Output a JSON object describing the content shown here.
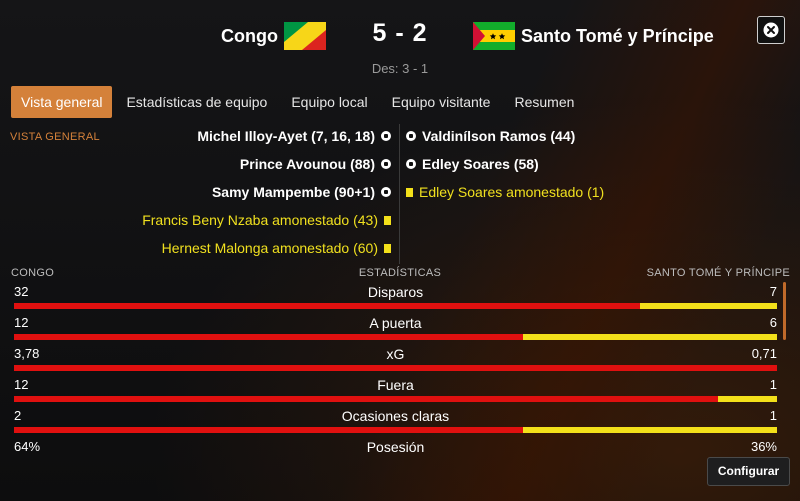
{
  "match": {
    "home_team": "Congo",
    "away_team": "Santo Tomé y Príncipe",
    "score": "5 - 2",
    "halftime": "Des: 3 - 1"
  },
  "tabs": [
    {
      "label": "Vista general",
      "active": true
    },
    {
      "label": "Estadísticas de equipo",
      "active": false
    },
    {
      "label": "Equipo local",
      "active": false
    },
    {
      "label": "Equipo visitante",
      "active": false
    },
    {
      "label": "Resumen",
      "active": false
    }
  ],
  "section_label": "VISTA GENERAL",
  "events": {
    "home": [
      {
        "text": "Michel Illoy-Ayet (7, 16, 18)",
        "icon": "ball-icon"
      },
      {
        "text": "Prince Avounou (88)",
        "icon": "ball-icon"
      },
      {
        "text": "Samy Mampembe (90+1)",
        "icon": "ball-icon"
      },
      {
        "text": "Francis Beny Nzaba amonestado (43)",
        "icon": "yellow-card-icon"
      },
      {
        "text": "Hernest Malonga amonestado (60)",
        "icon": "yellow-card-icon"
      }
    ],
    "away": [
      {
        "text": "Valdinílson Ramos (44)",
        "icon": "ball-icon"
      },
      {
        "text": "Edley Soares (58)",
        "icon": "ball-icon"
      },
      {
        "text": "Edley Soares amonestado (1)",
        "icon": "yellow-card-icon"
      }
    ]
  },
  "stats_header": {
    "left": "CONGO",
    "center": "ESTADÍSTICAS",
    "right": "SANTO TOMÉ Y PRÍNCIPE"
  },
  "stats": [
    {
      "name": "Disparos",
      "home": "32",
      "away": "7",
      "home_share": 0.821
    },
    {
      "name": "A puerta",
      "home": "12",
      "away": "6",
      "home_share": 0.667
    },
    {
      "name": "xG",
      "home": "3,78",
      "away": "0,71",
      "home_share": 1.0
    },
    {
      "name": "Fuera",
      "home": "12",
      "away": "1",
      "home_share": 0.923
    },
    {
      "name": "Ocasiones claras",
      "home": "2",
      "away": "1",
      "home_share": 0.667
    },
    {
      "name": "Posesión",
      "home": "64%",
      "away": "36%",
      "home_share": 0.64
    }
  ],
  "buttons": {
    "configure": "Configurar"
  },
  "colors": {
    "accent": "#d4813a",
    "home_bar": "#e0100f",
    "away_bar": "#f3e01a",
    "card_text": "#f0e01f"
  }
}
